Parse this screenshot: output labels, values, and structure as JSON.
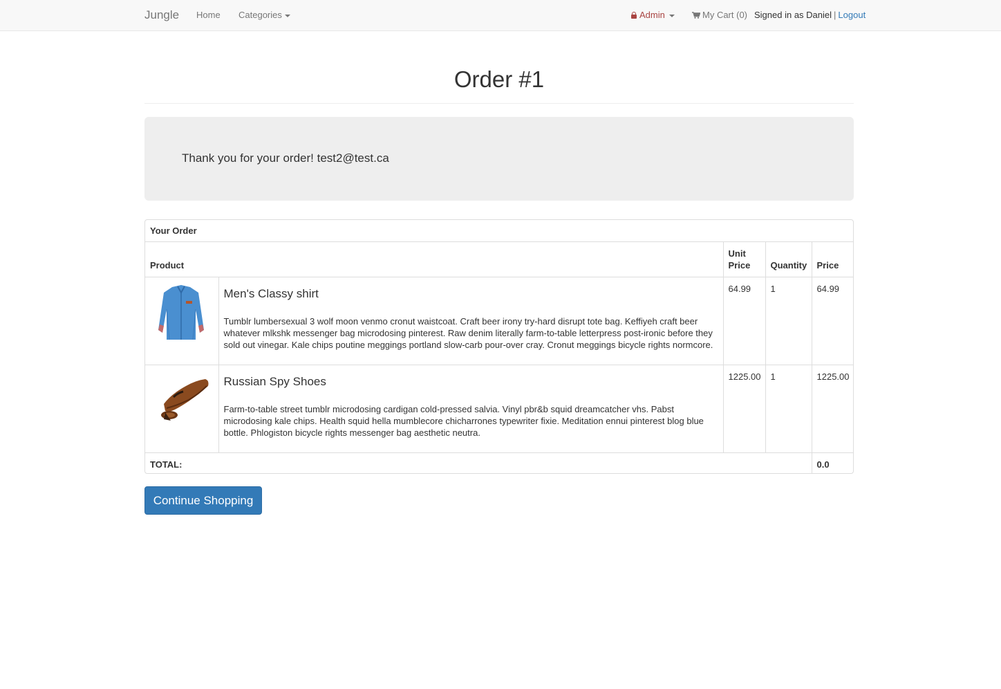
{
  "navbar": {
    "brand": "Jungle",
    "home": "Home",
    "categories": "Categories",
    "admin": "Admin",
    "cart": "My Cart (0)",
    "signed_in": "Signed in as Daniel",
    "separator": "|",
    "logout": "Logout"
  },
  "page": {
    "title": "Order #1",
    "thank_you": "Thank you for your order! test2@test.ca"
  },
  "order": {
    "heading": "Your Order",
    "columns": {
      "product": "Product",
      "unit_price": "Unit Price",
      "quantity": "Quantity",
      "price": "Price"
    },
    "items": [
      {
        "name": "Men's Classy shirt",
        "description": "Tumblr lumbersexual 3 wolf moon venmo cronut waistcoat. Craft beer irony try-hard disrupt tote bag. Keffiyeh craft beer whatever mlkshk messenger bag microdosing pinterest. Raw denim literally farm-to-table letterpress post-ironic before they sold out vinegar. Kale chips poutine meggings portland slow-carb pour-over cray. Cronut meggings bicycle rights normcore.",
        "unit_price": "64.99",
        "quantity": "1",
        "price": "64.99",
        "image": "shirt-image"
      },
      {
        "name": "Russian Spy Shoes",
        "description": "Farm-to-table street tumblr microdosing cardigan cold-pressed salvia. Vinyl pbr&b squid dreamcatcher vhs. Pabst microdosing kale chips. Health squid hella mumblecore chicharrones typewriter fixie. Meditation ennui pinterest blog blue bottle. Phlogiston bicycle rights messenger bag aesthetic neutra.",
        "unit_price": "1225.00",
        "quantity": "1",
        "price": "1225.00",
        "image": "shoe-image"
      }
    ],
    "total_label": "TOTAL:",
    "total_value": "0.0"
  },
  "actions": {
    "continue": "Continue Shopping"
  },
  "colors": {
    "accent": "#337ab7",
    "admin": "#a94442",
    "navbar_bg": "#f8f8f8",
    "jumbotron_bg": "#eeeeee"
  }
}
